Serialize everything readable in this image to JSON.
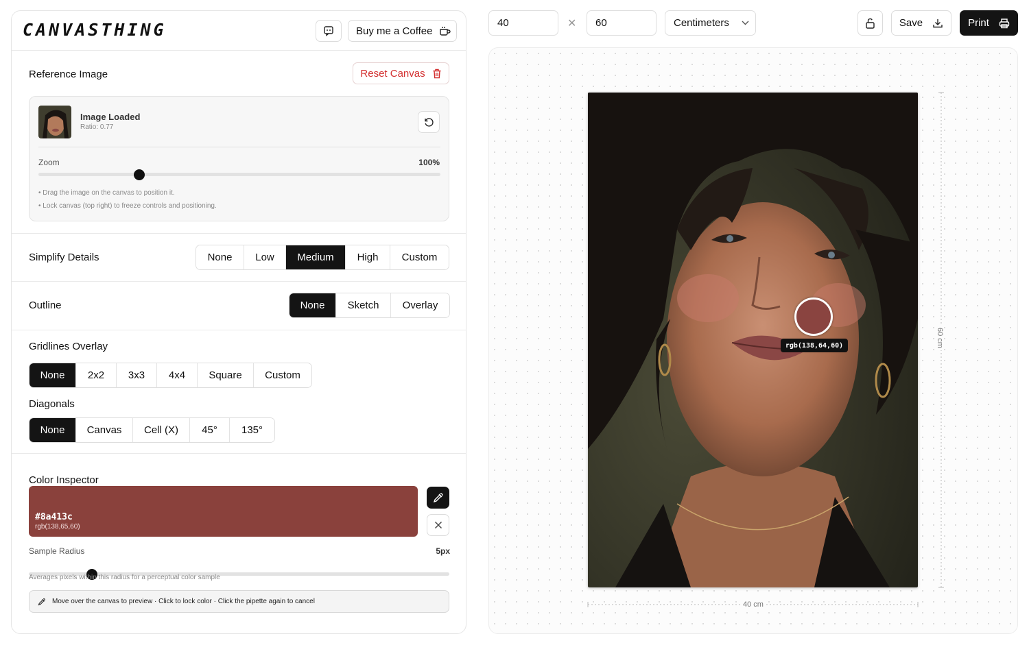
{
  "app": {
    "title": "CANVASTHING"
  },
  "header": {
    "coffee_label": "Buy me a Coffee"
  },
  "reference": {
    "title": "Reference Image",
    "reset_label": "Reset Canvas",
    "status": "Image Loaded",
    "ratio": "Ratio: 0.77",
    "zoom_label": "Zoom",
    "zoom_value": "100%",
    "zoom_fraction": 0.25,
    "hints": [
      "• Drag the image on the canvas to position it.",
      "• Lock canvas (top right) to freeze controls and positioning."
    ]
  },
  "simplify": {
    "title": "Simplify Details",
    "options": [
      "None",
      "Low",
      "Medium",
      "High",
      "Custom"
    ],
    "selected": "Medium"
  },
  "outline": {
    "title": "Outline",
    "options": [
      "None",
      "Sketch",
      "Overlay"
    ],
    "selected": "None"
  },
  "gridlines": {
    "title": "Gridlines Overlay",
    "options": [
      "None",
      "2x2",
      "3x3",
      "4x4",
      "Square",
      "Custom"
    ],
    "selected": "None"
  },
  "diagonals": {
    "title": "Diagonals",
    "options": [
      "None",
      "Canvas",
      "Cell (X)",
      "45°",
      "135°"
    ],
    "selected": "None"
  },
  "color_inspector": {
    "title": "Color Inspector",
    "hex": "#8a413c",
    "rgb": "rgb(138,65,60)",
    "swatch_color": "#8a413c",
    "radius_label": "Sample Radius",
    "radius_value": "5px",
    "radius_fraction": 0.15,
    "radius_hint": "Averages pixels within this radius for a perceptual color sample",
    "instruction": "Move over the canvas to preview · Click to lock color · Click the pipette again to cancel"
  },
  "toolbar": {
    "width_value": "40",
    "height_value": "60",
    "unit": "Centimeters",
    "save_label": "Save",
    "print_label": "Print"
  },
  "canvas": {
    "width_label": "40 cm",
    "height_label": "60 cm",
    "picker_readout": "rgb(138,64,60)",
    "picker_color": "#8a4440"
  },
  "colors": {
    "accent": "#141414",
    "danger": "#d32f2f"
  }
}
